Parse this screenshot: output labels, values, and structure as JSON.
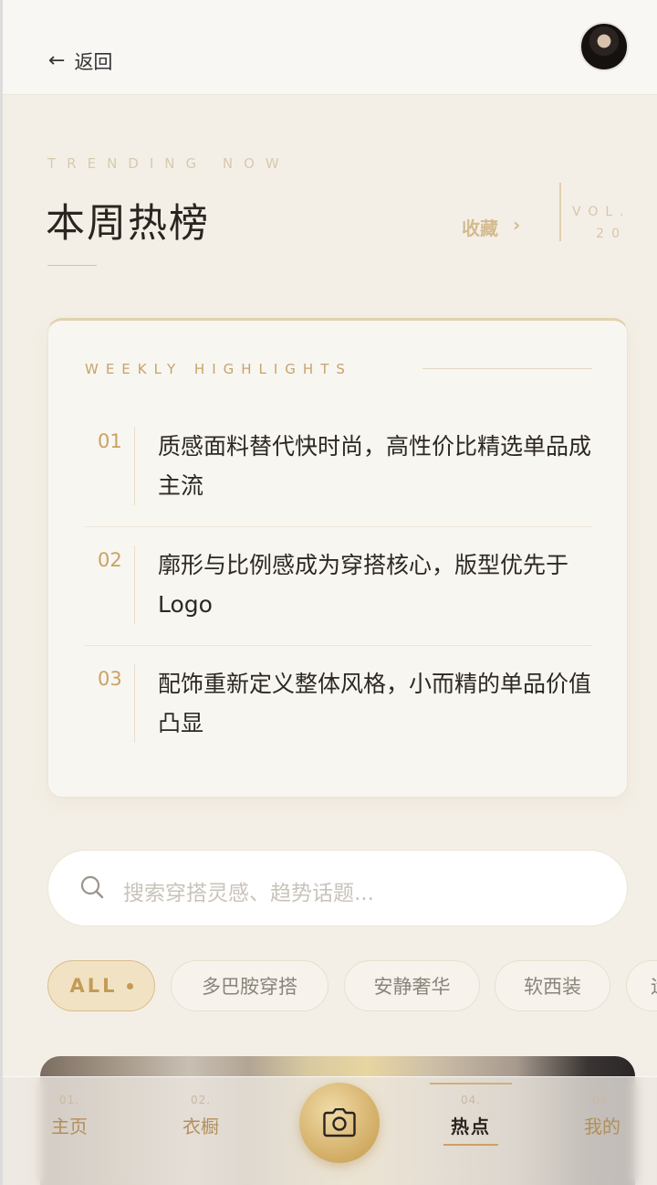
{
  "header": {
    "back_label": "返回",
    "back_icon": "arrow-left-icon",
    "avatar_icon": "user-avatar"
  },
  "hero": {
    "eyebrow": "TRENDING NOW",
    "title": "本周热榜",
    "favorite_label": "收藏",
    "favorite_chevron": "›",
    "vol_label": "VOL.",
    "vol_number": "20"
  },
  "highlights": {
    "heading": "WEEKLY HIGHLIGHTS",
    "items": [
      {
        "num": "01",
        "text": "质感面料替代快时尚，高性价比精选单品成主流"
      },
      {
        "num": "02",
        "text": "廓形与比例感成为穿搭核心，版型优先于 Logo"
      },
      {
        "num": "03",
        "text": "配饰重新定义整体风格，小而精的单品价值凸显"
      }
    ]
  },
  "search": {
    "placeholder": "搜索穿搭灵感、趋势话题..."
  },
  "chips": [
    {
      "label": "ALL",
      "active": true
    },
    {
      "label": "多巴胺穿搭",
      "active": false
    },
    {
      "label": "安静奢华",
      "active": false
    },
    {
      "label": "软西装",
      "active": false
    },
    {
      "label": "运",
      "active": false
    }
  ],
  "nav": {
    "items": [
      {
        "num": "01.",
        "label": "主页"
      },
      {
        "num": "02.",
        "label": "衣橱"
      },
      {
        "num": "04.",
        "label": "热点",
        "active": true
      },
      {
        "num": "05.",
        "label": "我的"
      }
    ],
    "camera_icon": "camera-icon"
  },
  "colors": {
    "background": "#f4efe6",
    "accent_gold": "#c9a265",
    "text_dark": "#2a2520"
  }
}
